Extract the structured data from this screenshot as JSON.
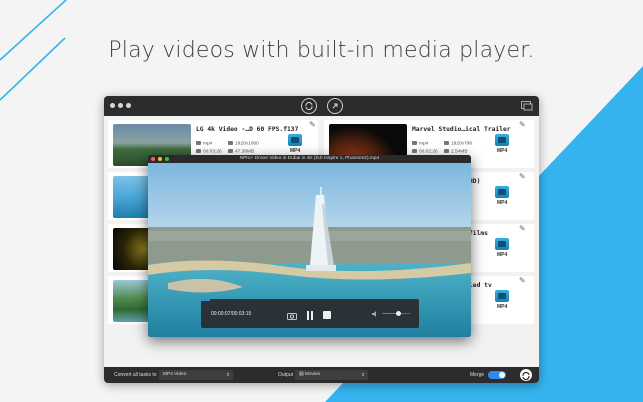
{
  "headline": "Play videos with built-in media player.",
  "colors": {
    "accent_blue": "#35b3ee",
    "toggle_blue": "#2e8cf0",
    "titlebar": "#2c2c2e"
  },
  "toolbar": {
    "left_icon": "convert-icon",
    "right_icon": "download-icon",
    "corner_icon": "media-library-icon"
  },
  "tasks": [
    {
      "title": "LG 4k Video -…D 60 FPS.f137",
      "format": "mp4",
      "resolution": "1920x1080",
      "duration": "00:03:26",
      "size": "47.38MB",
      "output_format": "MP4"
    },
    {
      "title": "Marvel Studio…ical Trailer",
      "format": "mp4",
      "resolution": "1920x798",
      "duration": "00:02:26",
      "size": "2.54MB",
      "output_format": "MP4"
    },
    {
      "title": "HD)",
      "output_format": "MP4"
    },
    {
      "title": "films",
      "output_format": "MP4"
    },
    {
      "title": "led tv",
      "output_format": "MP4"
    }
  ],
  "player": {
    "title": "NPro+ Drone Video in Dubai in 4K (DJI Inspire 1, Phantom2).mp4",
    "time": "00:00:07/00:03:15",
    "volume": 0.6,
    "progress": 0.04
  },
  "bottom": {
    "convert_label": "Convert all tasks to",
    "convert_value": "MP4 Video",
    "output_label": "Output",
    "output_value": "Movies",
    "merge_label": "Merge",
    "merge_on": true
  }
}
